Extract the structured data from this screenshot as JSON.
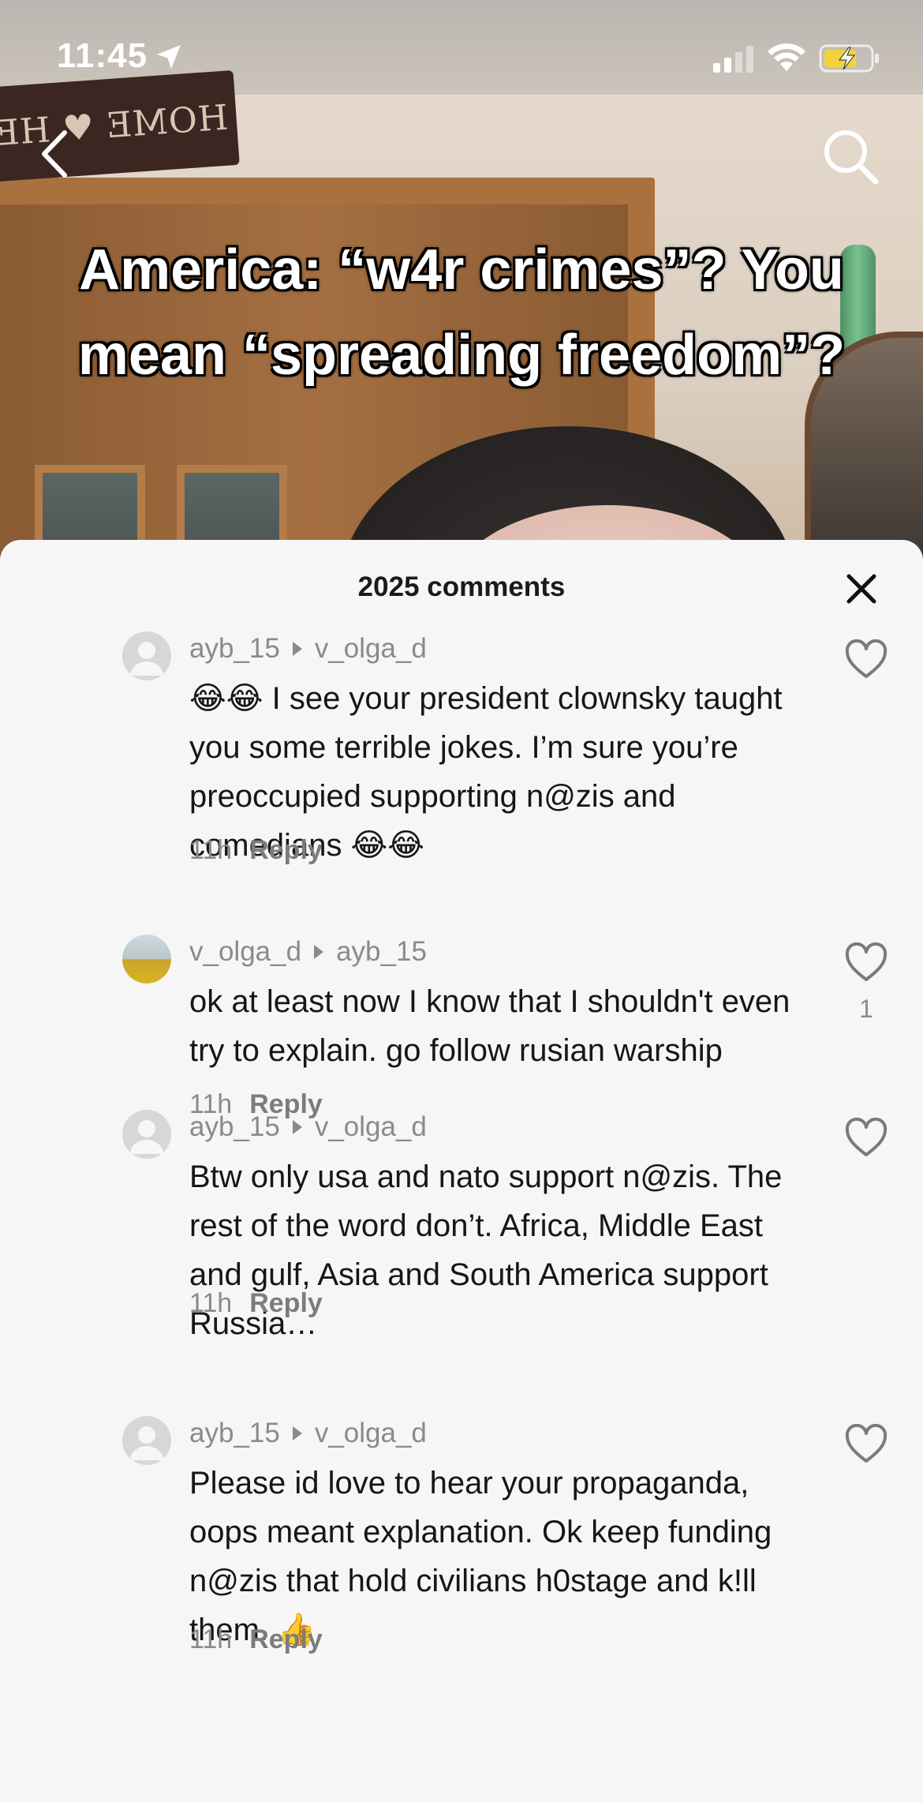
{
  "status_bar": {
    "time": "11:45"
  },
  "video": {
    "caption": "America: “w4r crimes”? You mean “spreading freedom”?",
    "sign_text": "HOME ♥ HE"
  },
  "sheet": {
    "title": "2025 comments"
  },
  "comments": [
    {
      "author": "ayb_15",
      "reply_to": "v_olga_d",
      "text": "😂😂 I see your president clownsky taught you some terrible jokes. I’m sure you’re preoccupied supporting n@zis and comedians 😂😂",
      "time": "11h",
      "reply_label": "Reply",
      "likes": ""
    },
    {
      "author": "v_olga_d",
      "reply_to": "ayb_15",
      "text": "ok at least now I know that I shouldn't even try to explain. go follow rusian warship",
      "time": "11h",
      "reply_label": "Reply",
      "likes": "1"
    },
    {
      "author": "ayb_15",
      "reply_to": "v_olga_d",
      "text": "Btw only usa and nato support n@zis. The rest of the word don’t. Africa, Middle East and gulf, Asia and South America support Russia…",
      "time": "11h",
      "reply_label": "Reply",
      "likes": ""
    },
    {
      "author": "ayb_15",
      "reply_to": "v_olga_d",
      "text": "Please id love to hear your propaganda, oops meant explanation. Ok keep funding n@zis that hold civilians h0stage and k!ll them. 👍",
      "time": "11h",
      "reply_label": "Reply",
      "likes": ""
    }
  ],
  "icons": {
    "back": "chevron-left-icon",
    "search": "search-icon",
    "close": "close-icon",
    "like": "heart-outline-icon",
    "reply_arrow": "triangle-right-icon"
  },
  "colors": {
    "battery": "#f2d33d",
    "secondary_text": "#8a8a8a"
  }
}
